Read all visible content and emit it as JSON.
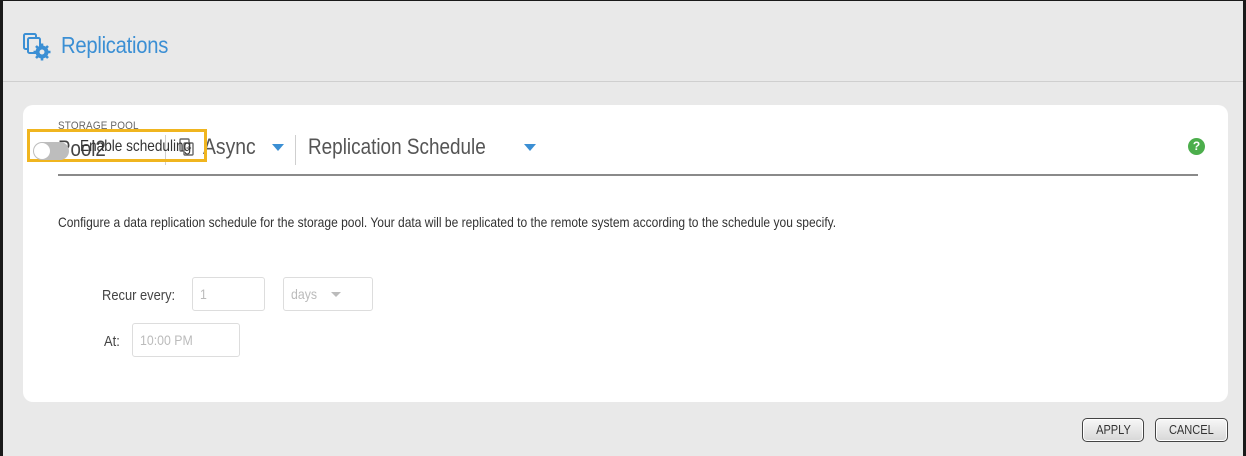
{
  "header": {
    "title": "Replications",
    "icon": "replication-settings-icon"
  },
  "pool": {
    "label": "STORAGE POOL",
    "name": "Pool2"
  },
  "mode": {
    "label": "Async"
  },
  "view": {
    "label": "Replication Schedule"
  },
  "help": {
    "glyph": "?"
  },
  "description": "Configure a data replication schedule for the storage pool. Your data will be replicated to the remote system according to the schedule you specify.",
  "scheduling": {
    "label": "Enable scheduling",
    "enabled": false
  },
  "recur": {
    "label": "Recur every:",
    "value": "1",
    "unit": "days"
  },
  "at": {
    "label": "At:",
    "value": "10:00 PM"
  },
  "buttons": {
    "apply": "APPLY",
    "cancel": "CANCEL"
  },
  "colors": {
    "accent": "#3b8fd4",
    "highlight": "#f0b51f",
    "help": "#4cae4c"
  }
}
